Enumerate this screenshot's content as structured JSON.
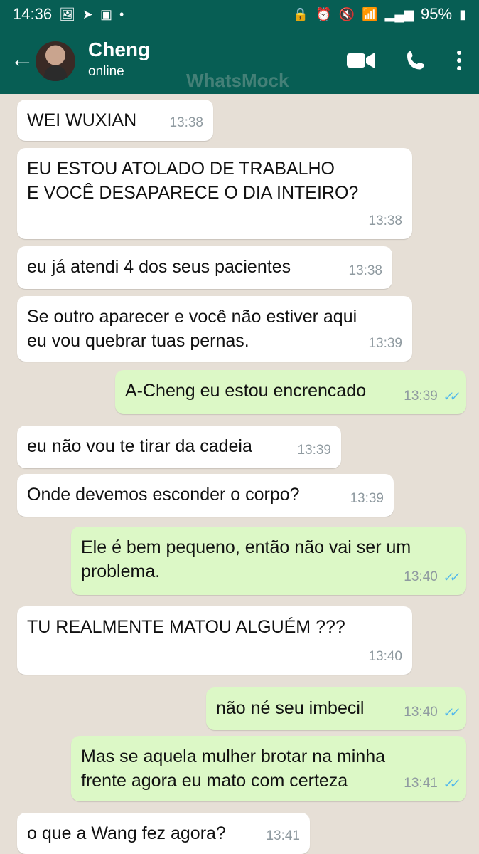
{
  "status_bar": {
    "time": "14:36",
    "battery": "95%"
  },
  "header": {
    "contact_name": "Cheng",
    "status": "online",
    "watermark": "WhatsMock"
  },
  "messages": [
    {
      "text": "WEI WUXIAN",
      "time": "13:38"
    },
    {
      "text": "EU ESTOU ATOLADO DE TRABALHO\nE VOCÊ DESAPARECE O DIA INTEIRO?",
      "time": "13:38"
    },
    {
      "text": "eu já atendi 4 dos seus pacientes",
      "time": "13:38"
    },
    {
      "text": "Se outro aparecer e você não estiver aqui\neu vou quebrar tuas pernas.",
      "time": "13:39"
    },
    {
      "text": "A-Cheng eu estou encrencado",
      "time": "13:39"
    },
    {
      "text": "eu não vou te tirar da cadeia",
      "time": "13:39"
    },
    {
      "text": "Onde devemos esconder o corpo?",
      "time": "13:39"
    },
    {
      "text": "Ele é bem pequeno, então não vai ser um\nproblema.",
      "time": "13:40"
    },
    {
      "text": "TU REALMENTE MATOU ALGUÉM ???",
      "time": "13:40"
    },
    {
      "text": "não né seu imbecil",
      "time": "13:40"
    },
    {
      "text": "Mas se aquela mulher brotar na minha\nfrente agora eu mato  com certeza",
      "time": "13:41"
    },
    {
      "text": "o que a Wang fez agora?",
      "time": "13:41"
    }
  ]
}
